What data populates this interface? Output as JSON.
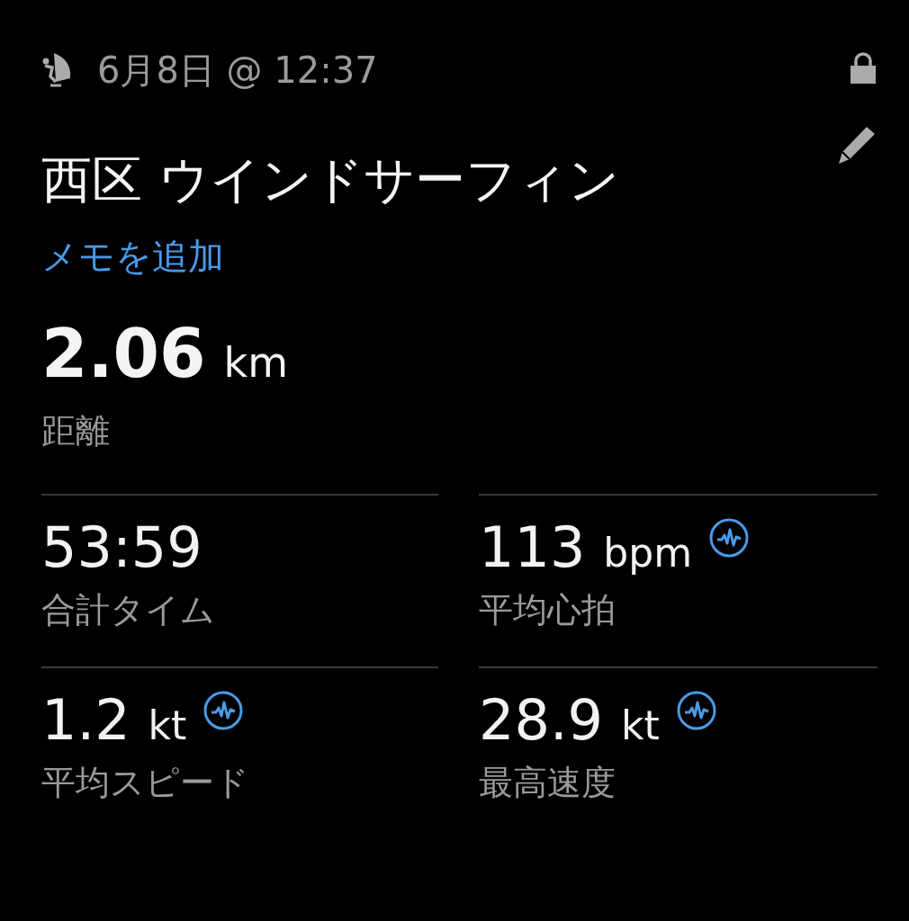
{
  "header": {
    "date": "6月8日 @ 12:37",
    "locked": true
  },
  "activity": {
    "title": "西区 ウインドサーフィン",
    "add_note": "メモを追加"
  },
  "distance": {
    "value": "2.06",
    "unit": "km",
    "label": "距離"
  },
  "stats": [
    {
      "value": "53:59",
      "label": "合計タイム",
      "sensor": false
    },
    {
      "value": "113",
      "unit": "bpm",
      "label": "平均心拍",
      "sensor": true
    },
    {
      "value": "1.2",
      "unit": "kt",
      "label": "平均スピード",
      "sensor": true
    },
    {
      "value": "28.9",
      "unit": "kt",
      "label": "最高速度",
      "sensor": true
    }
  ]
}
